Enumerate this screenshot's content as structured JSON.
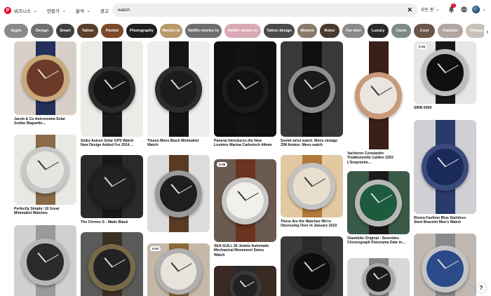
{
  "header": {
    "logo_letter": "P",
    "nav": [
      "비즈니스",
      "만들기",
      "분석",
      "광고"
    ],
    "search_value": "watch",
    "board_select": "모든 핀",
    "notification_count": "7"
  },
  "chips": [
    {
      "label": "Apple",
      "color": "#8a8a8a"
    },
    {
      "label": "Design",
      "color": "#6f6f6f"
    },
    {
      "label": "Smart",
      "color": "#3e3e3e"
    },
    {
      "label": "Tattoo",
      "color": "#5a3d2b"
    },
    {
      "label": "Pocket",
      "color": "#7a4a2a"
    },
    {
      "label": "Photography",
      "color": "#1f1f1f"
    },
    {
      "label": "Movies to",
      "color": "#b79a6a"
    },
    {
      "label": "Netflix movies to",
      "color": "#6e6e6e"
    },
    {
      "label": "Netflix shows to",
      "color": "#d9a9b6"
    },
    {
      "label": "Tattoo design",
      "color": "#4a4a4a"
    },
    {
      "label": "Women",
      "color": "#8a7a68"
    },
    {
      "label": "Rolex",
      "color": "#4a3a2c"
    },
    {
      "label": "For men",
      "color": "#8a8a8a"
    },
    {
      "label": "Luxury",
      "color": "#2a2a2a"
    },
    {
      "label": "Casio",
      "color": "#7d8a86"
    },
    {
      "label": "Cool",
      "color": "#6a5548"
    },
    {
      "label": "Fashion",
      "color": "#b3a6a0"
    },
    {
      "label": "Vintage",
      "color": "#c9c0b8"
    }
  ],
  "pins": [
    {
      "title": "Jacob & Co Astronomia Solar Zodiac Baguette…",
      "tag": ""
    },
    {
      "title": "Perfectly Simple: 10 Great Minimalist Watches",
      "tag": ""
    },
    {
      "title": "Audemars Piguet Royal Oak Double Balance Wheel",
      "tag": ""
    },
    {
      "title": "Seiko Astron Solar GPS Watch New Design Added For 2014…",
      "tag": ""
    },
    {
      "title": "The Chrono S - Matte Black",
      "tag": ""
    },
    {
      "title": "",
      "tag": ""
    },
    {
      "title": "Tinseo Mens Black Minimalist Watch",
      "tag": ""
    },
    {
      "title": "",
      "tag": ""
    },
    {
      "title": "",
      "tag": "0:53"
    },
    {
      "title": "Panerai Introduces the New Luminor Marina Carbotech 44mm",
      "tag": ""
    },
    {
      "title": "SEA-GULL 26 Jewels Automatic Mechanical Movement Swiss Watch",
      "tag": "0:38"
    },
    {
      "title": "",
      "tag": ""
    },
    {
      "title": "Soviet wrist watch. Mens vintage ZIM Aviator. Mens watch",
      "tag": ""
    },
    {
      "title": "These Are the Watches We're Obsessing Over in January 2019",
      "tag": ""
    },
    {
      "title": "",
      "tag": ""
    },
    {
      "title": "Vacheron Constantin Traditionnelle Calibre 2253 L'Empreinte…",
      "tag": ""
    },
    {
      "title": "Glashütte Original - Seventies Chronograph Panorama Date in…",
      "tag": ""
    },
    {
      "title": "",
      "tag": ""
    },
    {
      "title": "SINN 6000",
      "tag": "0:15"
    },
    {
      "title": "Rivera Fashion Blue Stainless Steel Bracelet Men's Watch",
      "tag": ""
    },
    {
      "title": "",
      "tag": ""
    }
  ],
  "help_label": "?"
}
